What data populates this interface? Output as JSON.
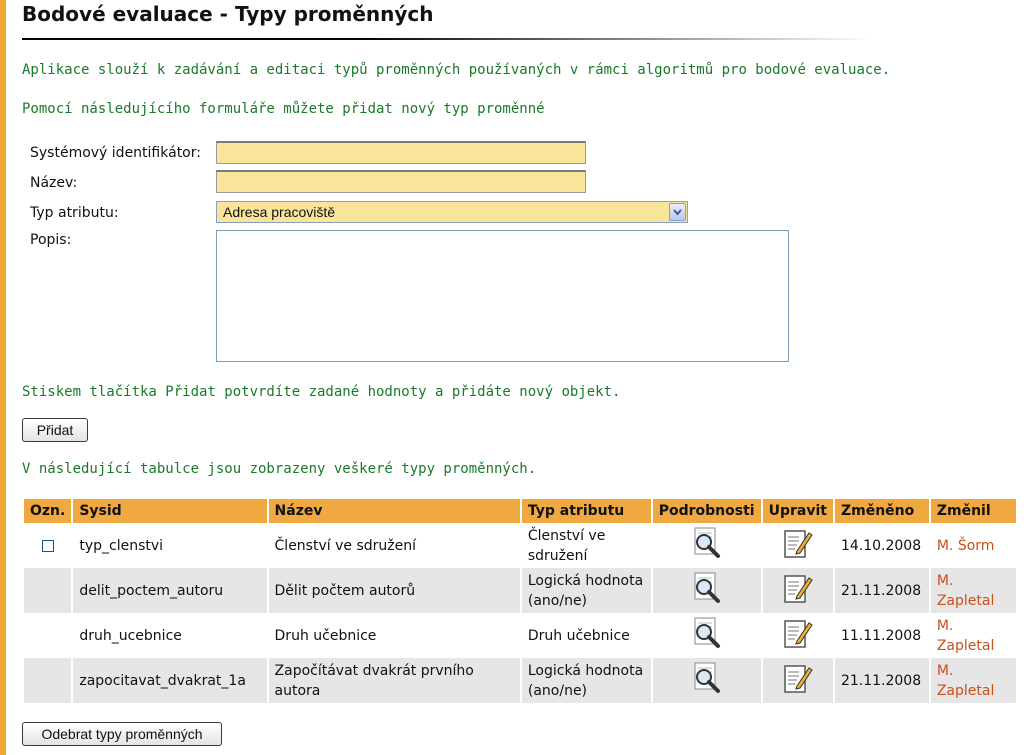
{
  "page": {
    "title": "Bodové evaluace - Typy proměnných",
    "intro": "Aplikace slouží k zadávání a editaci typů proměnných používaných v rámci algoritmů pro bodové evaluace.",
    "form_intro": "Pomocí následujícího formuláře můžete přidat nový typ proměnné",
    "submit_hint": "Stiskem tlačítka Přidat potvrdíte zadané hodnoty a přidáte nový objekt.",
    "table_intro": "V následující tabulce jsou zobrazeny veškeré typy proměnných."
  },
  "form": {
    "sysid_label": "Systémový identifikátor:",
    "sysid_value": "",
    "name_label": "Název:",
    "name_value": "",
    "type_label": "Typ atributu:",
    "type_selected": "Adresa pracoviště",
    "desc_label": "Popis:",
    "desc_value": "",
    "add_button": "Přidat"
  },
  "table": {
    "headers": [
      "Ozn.",
      "Sysid",
      "Název",
      "Typ atributu",
      "Podrobnosti",
      "Upravit",
      "Změněno",
      "Změnil"
    ],
    "rows": [
      {
        "sysid": "typ_clenstvi",
        "name": "Členství ve sdružení",
        "type": "Členství ve sdružení",
        "changed": "14.10.2008",
        "user": "M. Šorm",
        "has_checkbox": true
      },
      {
        "sysid": "delit_poctem_autoru",
        "name": "Dělit počtem autorů",
        "type": "Logická hodnota (ano/ne)",
        "changed": "21.11.2008",
        "user": "M. Zapletal",
        "has_checkbox": false
      },
      {
        "sysid": "druh_ucebnice",
        "name": "Druh učebnice",
        "type": "Druh učebnice",
        "changed": "11.11.2008",
        "user": "M. Zapletal",
        "has_checkbox": false
      },
      {
        "sysid": "zapocitavat_dvakrat_1a",
        "name": "Započítávat dvakrát prvního autora",
        "type": "Logická hodnota (ano/ne)",
        "changed": "21.11.2008",
        "user": "M. Zapletal",
        "has_checkbox": false
      }
    ],
    "remove_button": "Odebrat typy proměnných"
  },
  "icons": {
    "details": "magnifier-icon",
    "edit": "edit-document-icon"
  },
  "colors": {
    "accent": "#f0a840",
    "text_green": "#1a7a2a",
    "input_bg": "#f9e59a",
    "user_link": "#c8501c"
  }
}
